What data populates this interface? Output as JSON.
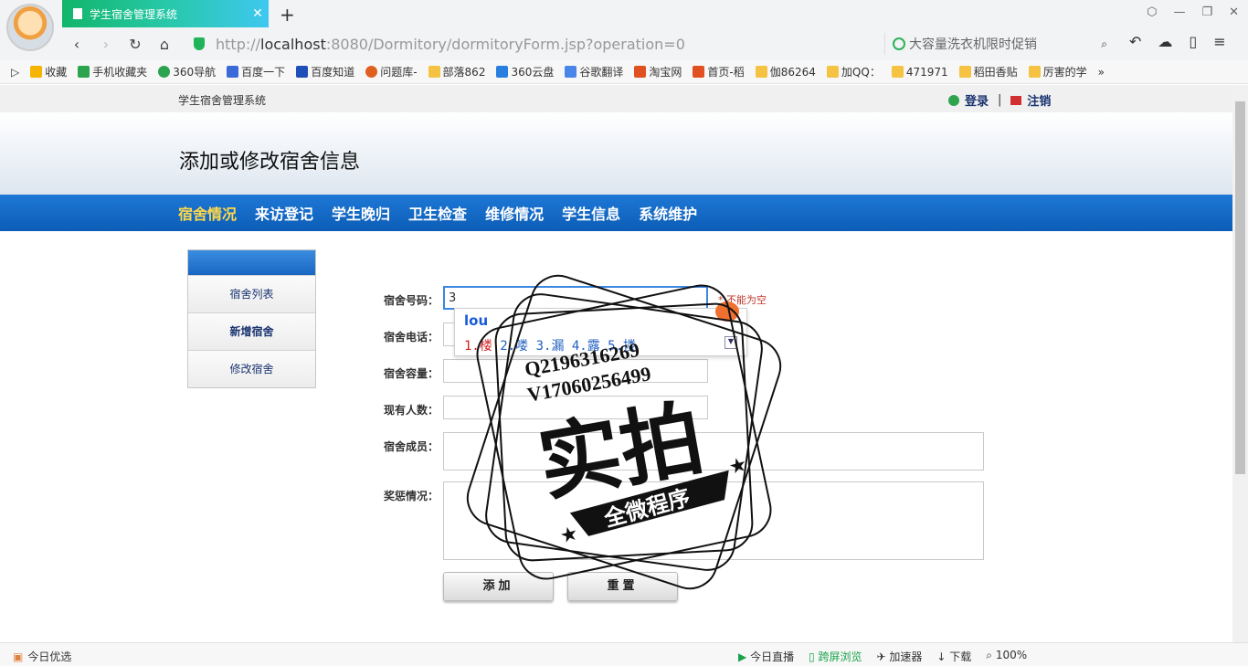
{
  "browser": {
    "tab_title": "学生宿舍管理系统",
    "url_prefix": "http://",
    "url_host": "localhost",
    "url_rest": ":8080/Dormitory/dormitoryForm.jsp?operation=0",
    "search_placeholder": "大容量洗衣机限时促销",
    "bookmarks": [
      "收藏",
      "手机收藏夹",
      "360导航",
      "百度一下",
      "百度知道",
      "问题库-",
      "部落862",
      "360云盘",
      "谷歌翻译",
      "淘宝网",
      "首页-稻",
      "伽86264",
      "加QQ：",
      "471971",
      "稻田香贴",
      "厉害的学"
    ]
  },
  "site": {
    "name": "学生宿舍管理系统",
    "login": "登录",
    "logout": "注销",
    "page_title": "添加或修改宿舍信息"
  },
  "mainnav": [
    "宿舍情况",
    "来访登记",
    "学生晚归",
    "卫生检查",
    "维修情况",
    "学生信息",
    "系统维护"
  ],
  "sidebar": [
    "宿舍列表",
    "新增宿舍",
    "修改宿舍"
  ],
  "form": {
    "room_no_label": "宿舍号码：",
    "room_no_value": "3",
    "required_note": "* 不能为空",
    "phone_label": "宿舍电话：",
    "capacity_label": "宿舍容量：",
    "current_label": "现有人数：",
    "members_label": "宿舍成员：",
    "awards_label": "奖惩情况：",
    "add_button": "添加",
    "reset_button": "重置"
  },
  "ime": {
    "pinyin": "lou",
    "candidate1": "1.楼",
    "candidates_rest": "2.喽 3.漏 4.露 5.搂"
  },
  "stamp": {
    "line1": "Q2196316269",
    "line2": "V17060256499",
    "big": "实拍",
    "banner": "全微程序"
  },
  "status": {
    "left": "今日优选",
    "items": [
      "今日直播",
      "跨屏浏览",
      "加速器",
      "下载",
      "100%"
    ]
  }
}
